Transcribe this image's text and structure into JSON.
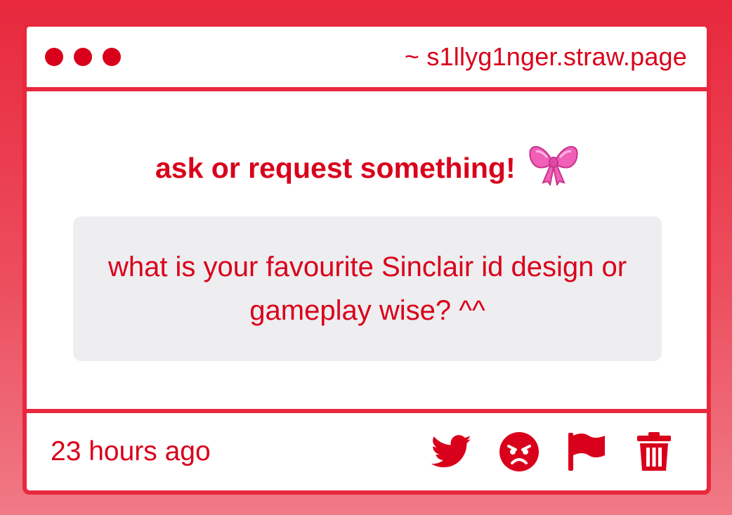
{
  "window": {
    "url": "~ s1llyg1nger.straw.page"
  },
  "main": {
    "heading": "ask or request something!",
    "heading_icon": "ribbon-bow-icon",
    "question": "what is your favourite Sinclair id design or gameplay wise? ^^"
  },
  "footer": {
    "timestamp": "23 hours ago",
    "actions": [
      {
        "icon": "twitter-bird-icon"
      },
      {
        "icon": "angry-face-icon"
      },
      {
        "icon": "flag-icon"
      },
      {
        "icon": "trash-icon"
      }
    ]
  },
  "colors": {
    "accent": "#d9001b",
    "border": "#e8283d",
    "question_bg": "#eeedef",
    "bow": "#f060b8"
  }
}
